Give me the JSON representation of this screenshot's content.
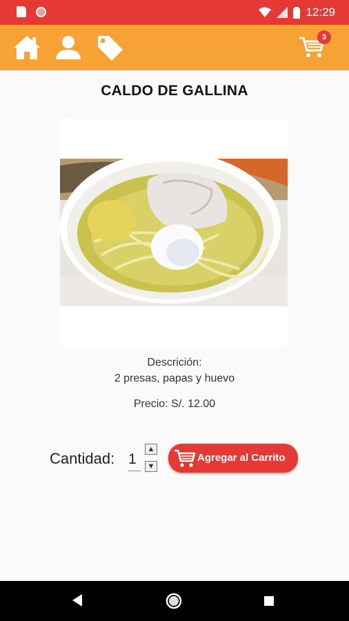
{
  "status_bar": {
    "time": "12:29",
    "icons": [
      "sd-card-icon",
      "record-icon",
      "wifi-icon",
      "signal-icon",
      "battery-icon"
    ]
  },
  "app_bar": {
    "color": "#f6a234",
    "nav_icons": [
      "home-icon",
      "user-icon",
      "tag-icon"
    ],
    "cart_badge": "3"
  },
  "product": {
    "title": "CALDO DE GALLINA",
    "image_alt": "caldo de gallina",
    "description_label": "Descrición:",
    "description": "2 presas, papas y huevo",
    "price": "Precio: S/. 12.00"
  },
  "order": {
    "quantity_label": "Cantidad:",
    "quantity_value": "1",
    "add_button_label": "Agregar al Carrito",
    "accent": "#e53935"
  }
}
